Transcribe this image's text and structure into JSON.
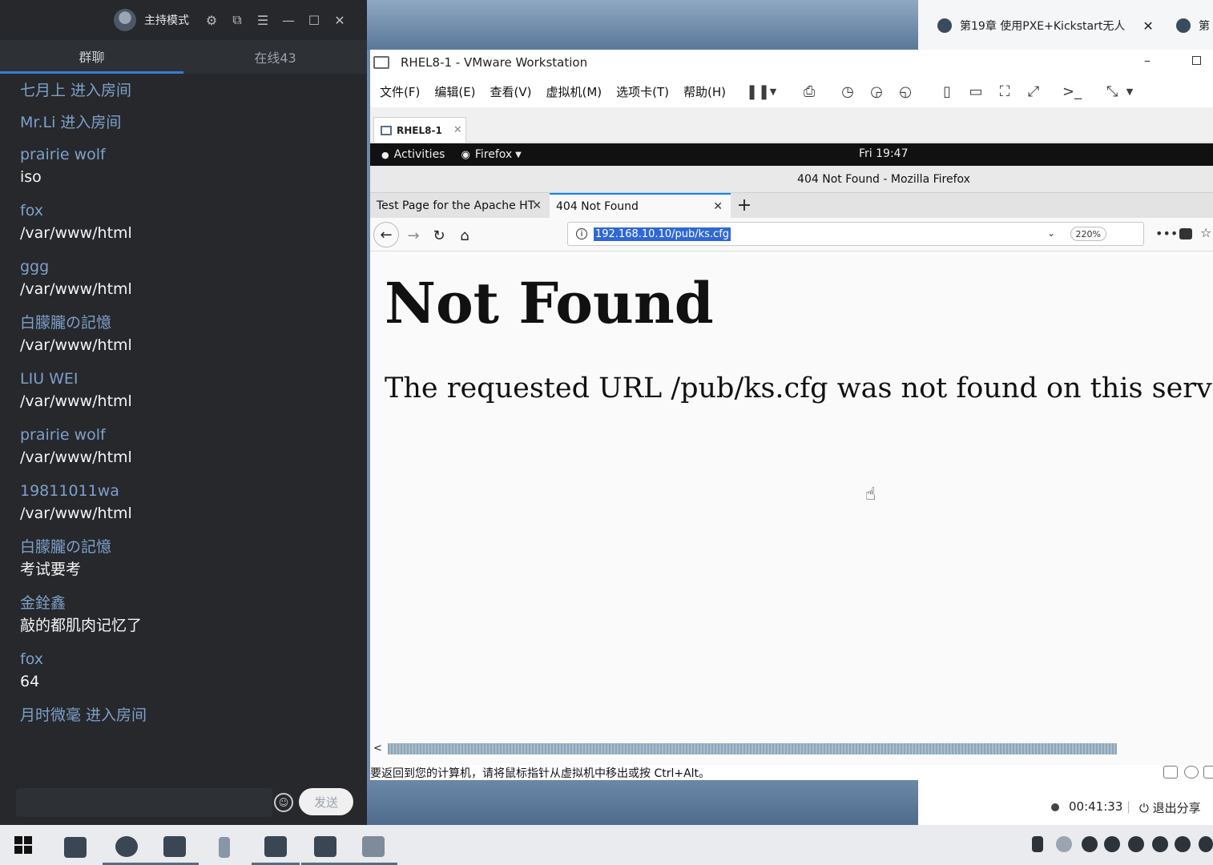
{
  "chat": {
    "mode_label": "主持模式",
    "tabs": [
      "群聊",
      "在线43"
    ],
    "messages": [
      {
        "name": "七月上 进入房间",
        "text": ""
      },
      {
        "name": "Mr.Li 进入房间",
        "text": ""
      },
      {
        "name": "prairie wolf",
        "text": "iso"
      },
      {
        "name": "fox",
        "text": "/var/www/html"
      },
      {
        "name": "ggg",
        "text": "/var/www/html"
      },
      {
        "name": "白朦朧の記憶",
        "text": "/var/www/html"
      },
      {
        "name": "LIU WEI",
        "text": "/var/www/html"
      },
      {
        "name": "prairie wolf",
        "text": "/var/www/html"
      },
      {
        "name": "19811011wa",
        "text": "/var/www/html"
      },
      {
        "name": "白朦朧の記憶",
        "text": "考试要考"
      },
      {
        "name": "金銓鑫",
        "text": "敲的都肌肉记忆了"
      },
      {
        "name": "fox",
        "text": "64"
      },
      {
        "name": "月时微毫 进入房间",
        "text": ""
      }
    ],
    "send_label": "发送"
  },
  "strip": {
    "tab1": "第19章 使用PXE+Kickstart无人",
    "tab2": "第"
  },
  "vmware": {
    "title": "RHEL8-1 - VMware Workstation",
    "menus": [
      "文件(F)",
      "编辑(E)",
      "查看(V)",
      "虚拟机(M)",
      "选项卡(T)",
      "帮助(H)"
    ],
    "tab_label": "RHEL8-1",
    "status_text": "要返回到您的计算机，请将鼠标指针从虚拟机中移出或按 Ctrl+Alt。"
  },
  "gnome": {
    "activities": "Activities",
    "app": "Firefox",
    "clock": "Fri 19:47"
  },
  "firefox": {
    "window_title": "404 Not Found - Mozilla Firefox",
    "tabs": [
      "Test Page for the Apache HT",
      "404 Not Found"
    ],
    "url": "192.168.10.10/pub/ks.cfg",
    "zoom": "220%",
    "page_heading": "Not Found",
    "page_text": "The requested URL /pub/ks.cfg was not found on this serv"
  },
  "recorder": {
    "time": "00:41:33",
    "exit_label": "退出分享"
  }
}
